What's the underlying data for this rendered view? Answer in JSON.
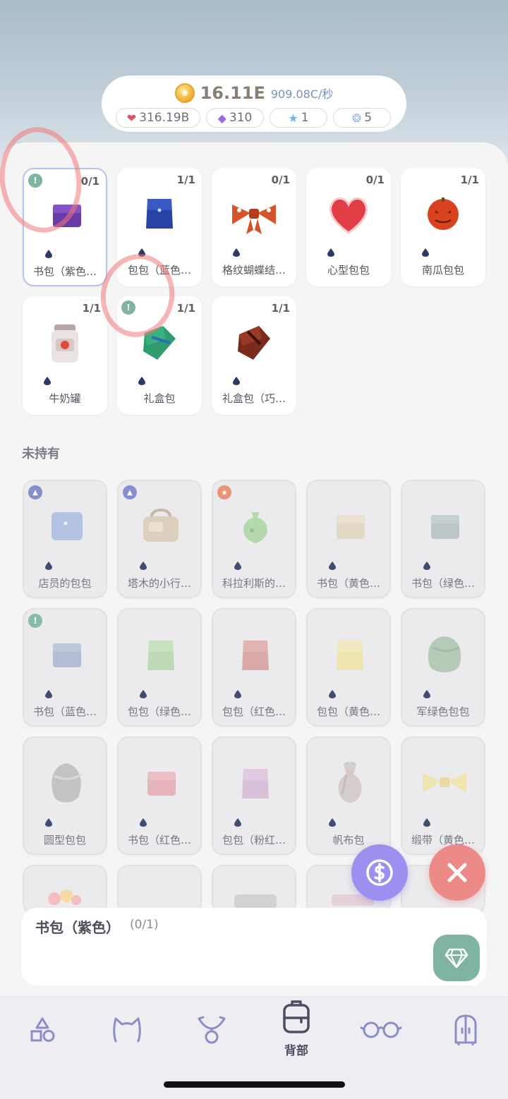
{
  "header": {
    "coins": "16.11E",
    "rate": "909.08C/秒",
    "hearts": "316.19B",
    "gems": "310",
    "stars": "1",
    "orbs": "5"
  },
  "owned": [
    {
      "name": "书包（紫色…",
      "count": "0/1",
      "badge": "!"
    },
    {
      "name": "包包（蓝色…",
      "count": "1/1",
      "badge": ""
    },
    {
      "name": "格纹蝴蝶结…",
      "count": "0/1",
      "badge": ""
    },
    {
      "name": "心型包包",
      "count": "0/1",
      "badge": ""
    },
    {
      "name": "南瓜包包",
      "count": "1/1",
      "badge": ""
    },
    {
      "name": "牛奶罐",
      "count": "1/1",
      "badge": ""
    },
    {
      "name": "礼盒包",
      "count": "1/1",
      "badge": "!"
    },
    {
      "name": "礼盒包（巧…",
      "count": "1/1",
      "badge": ""
    }
  ],
  "section_label": "未持有",
  "unowned": [
    {
      "name": "店员的包包",
      "badge": "cat"
    },
    {
      "name": "塔木的小行…",
      "badge": "cat"
    },
    {
      "name": "科拉利斯的…",
      "badge": "star"
    },
    {
      "name": "书包（黄色…",
      "badge": ""
    },
    {
      "name": "书包（绿色…",
      "badge": ""
    },
    {
      "name": "书包（蓝色…",
      "badge": "!"
    },
    {
      "name": "包包（绿色…",
      "badge": ""
    },
    {
      "name": "包包（红色…",
      "badge": ""
    },
    {
      "name": "包包（黄色…",
      "badge": ""
    },
    {
      "name": "军绿色包包",
      "badge": ""
    },
    {
      "name": "圆型包包",
      "badge": ""
    },
    {
      "name": "书包（红色…",
      "badge": ""
    },
    {
      "name": "包包（粉红…",
      "badge": ""
    },
    {
      "name": "帆布包",
      "badge": ""
    },
    {
      "name": "缎带（黄色…",
      "badge": ""
    }
  ],
  "detail": {
    "title": "书包（紫色）",
    "count": "(0/1)"
  },
  "nav": {
    "active_label": "背部",
    "icons": [
      "shapes-icon",
      "cat-ears-icon",
      "necklace-icon",
      "backpack-icon",
      "glasses-icon",
      "wardrobe-icon"
    ]
  },
  "colors": {
    "accent_purple": "#9b8ff0",
    "close_red": "#ec8a87",
    "gem_teal": "#7fb4a3"
  }
}
